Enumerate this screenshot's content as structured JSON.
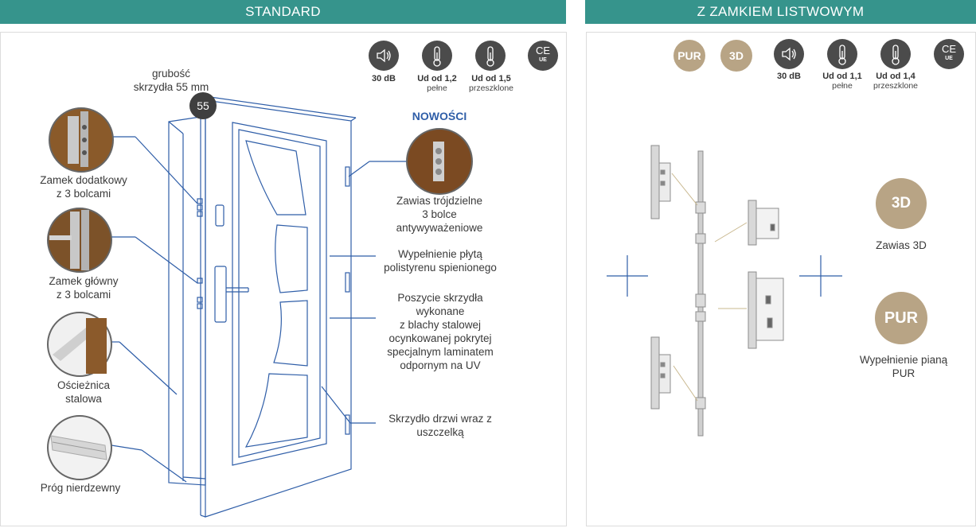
{
  "headers": {
    "left": "STANDARD",
    "right": "Z ZAMKIEM LISTWOWYM"
  },
  "colors": {
    "header_bg": "#36948c",
    "badge": "#b8a485",
    "icon_bg": "#4b4b4b",
    "line": "#2f5ea8",
    "new_label": "#2f5ea8"
  },
  "left": {
    "icons": [
      {
        "icon": "speaker-icon",
        "value": "30 dB",
        "sub": ""
      },
      {
        "icon": "thermometer-icon",
        "value": "Ud od 1,2",
        "sub": "pełne"
      },
      {
        "icon": "thermometer-icon",
        "value": "Ud od 1,5",
        "sub": "przeszklone"
      },
      {
        "icon": "ce-mark-icon",
        "mark": "CE",
        "mark_sub": "UE",
        "value": "",
        "sub": ""
      }
    ],
    "thickness_line1": "grubość",
    "thickness_line2": "skrzydła 55 mm",
    "thickness_badge": "55",
    "new_label": "NOWOŚCI",
    "labels": {
      "extra_lock": [
        "Zamek dodatkowy",
        "z 3 bolcami"
      ],
      "main_lock": [
        "Zamek główny",
        "z 3 bolcami"
      ],
      "frame": [
        "Ościeżnica",
        "stalowa"
      ],
      "threshold": [
        "Próg nierdzewny"
      ],
      "hinge": [
        "Zawias trójdzielne",
        "3 bolce",
        "antywyważeniowe"
      ],
      "filling": [
        "Wypełnienie płytą",
        "polistyrenu spienionego"
      ],
      "cladding": [
        "Poszycie skrzydła",
        "wykonane",
        "z blachy stalowej",
        "ocynkowanej pokrytej",
        "specjalnym laminatem",
        "odpornym na UV"
      ],
      "leaf": [
        "Skrzydło drzwi wraz z",
        "uszczelką"
      ]
    }
  },
  "right": {
    "badges": [
      "PUR",
      "3D"
    ],
    "icons": [
      {
        "icon": "speaker-icon",
        "value": "30 dB",
        "sub": ""
      },
      {
        "icon": "thermometer-icon",
        "value": "Ud od 1,1",
        "sub": "pełne"
      },
      {
        "icon": "thermometer-icon",
        "value": "Ud od 1,4",
        "sub": "przeszklone"
      },
      {
        "icon": "ce-mark-icon",
        "mark": "CE",
        "mark_sub": "UE",
        "value": "",
        "sub": ""
      }
    ],
    "feature_3d": {
      "badge": "3D",
      "label": "Zawias 3D"
    },
    "feature_pur": {
      "badge": "PUR",
      "label_line1": "Wypełnienie pianą",
      "label_line2": "PUR"
    }
  }
}
